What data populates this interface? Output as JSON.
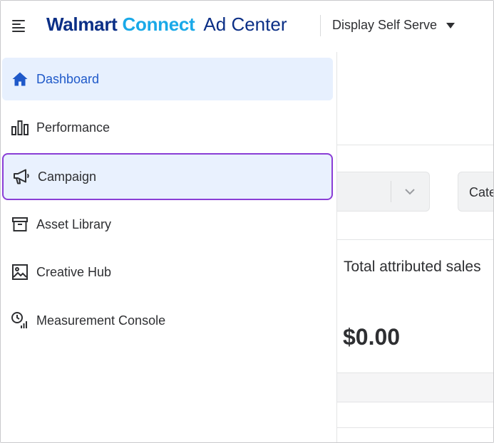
{
  "header": {
    "brand_walmart": "Walmart",
    "brand_connect": "Connect",
    "brand_adcenter": "Ad Center",
    "product_selector": "Display Self Serve"
  },
  "sidebar": {
    "items": [
      {
        "label": "Dashboard",
        "icon": "home-icon",
        "state": "active"
      },
      {
        "label": "Performance",
        "icon": "bar-chart-icon",
        "state": "normal"
      },
      {
        "label": "Campaign",
        "icon": "megaphone-icon",
        "state": "hover-highlighted"
      },
      {
        "label": "Asset Library",
        "icon": "archive-box-icon",
        "state": "normal"
      },
      {
        "label": "Creative Hub",
        "icon": "image-icon",
        "state": "normal"
      },
      {
        "label": "Measurement Console",
        "icon": "clock-signal-icon",
        "state": "normal"
      }
    ]
  },
  "main": {
    "filter2_partial": "Cate",
    "metric_label": "Total attributed sales",
    "metric_value": "$0.00"
  },
  "colors": {
    "brand_navy": "#0b2f86",
    "brand_blue": "#1aa9e8",
    "active_text": "#1f59c9",
    "active_bg": "#e7f0fe",
    "highlight_border": "#8a3ed6"
  }
}
